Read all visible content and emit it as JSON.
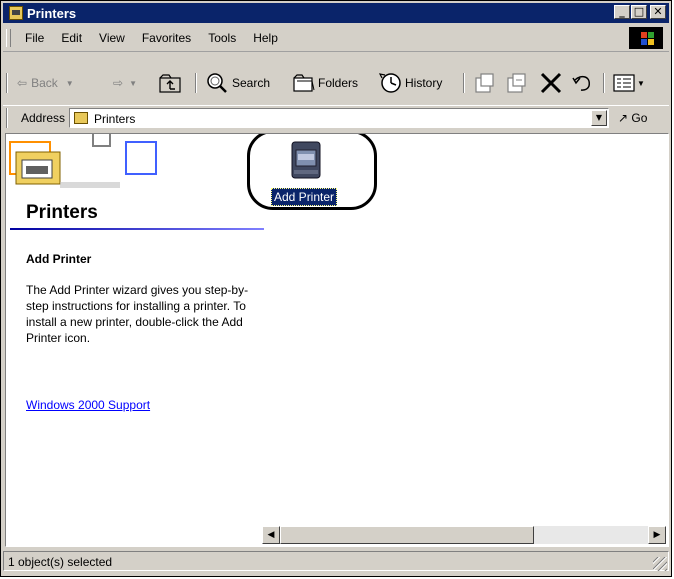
{
  "window": {
    "title": "Printers"
  },
  "menu": [
    "File",
    "Edit",
    "View",
    "Favorites",
    "Tools",
    "Help"
  ],
  "toolbar": {
    "back": "Back",
    "search": "Search",
    "folders": "Folders",
    "history": "History"
  },
  "address": {
    "label": "Address",
    "value": "Printers",
    "go": "Go"
  },
  "sidebar": {
    "title": "Printers",
    "subtitle": "Add Printer",
    "description": "The Add Printer wizard gives you step-by-step instructions for installing a printer. To install a new printer, double-click the Add Printer icon.",
    "link": "Windows 2000 Support"
  },
  "items": [
    {
      "label": "Add Printer",
      "icon": "add-printer-icon",
      "selected": true
    }
  ],
  "status": {
    "text": "1 object(s) selected"
  },
  "colors": {
    "titlebar": "#0a246a",
    "face": "#d4d0c8",
    "link": "#0000ff",
    "selection": "#0a246a"
  }
}
